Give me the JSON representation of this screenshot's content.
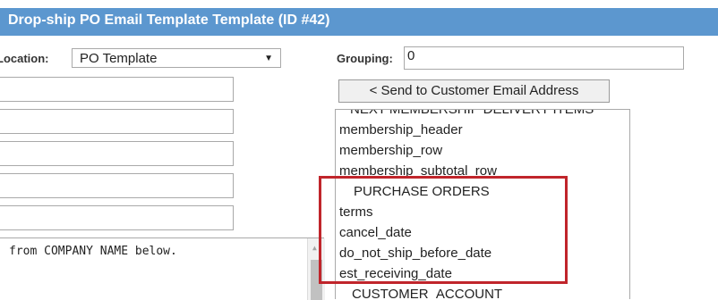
{
  "title": "Drop-ship PO Email Template Template (ID #42)",
  "location": {
    "label": "Location:",
    "value": "PO Template"
  },
  "grouping": {
    "label": "Grouping:",
    "value": "0"
  },
  "left_inputs": [
    "",
    "",
    "",
    "",
    ""
  ],
  "send_button": "< Send to Customer Email Address",
  "list_items": [
    "NEXT MEMBERSHIP DELIVERY ITEMS",
    "membership_header",
    "membership_row",
    "membership_subtotal_row",
    "PURCHASE ORDERS",
    "terms",
    "cancel_date",
    "do_not_ship_before_date",
    "est_receiving_date",
    "CUSTOMER_ACCOUNT"
  ],
  "textarea_text": "from COMPANY NAME below.",
  "colors": {
    "title_bg": "#5c97cf",
    "highlight": "#c0252b"
  },
  "icons": {
    "dropdown": "chevron-down-icon",
    "scroll_up": "arrow-up-icon"
  }
}
